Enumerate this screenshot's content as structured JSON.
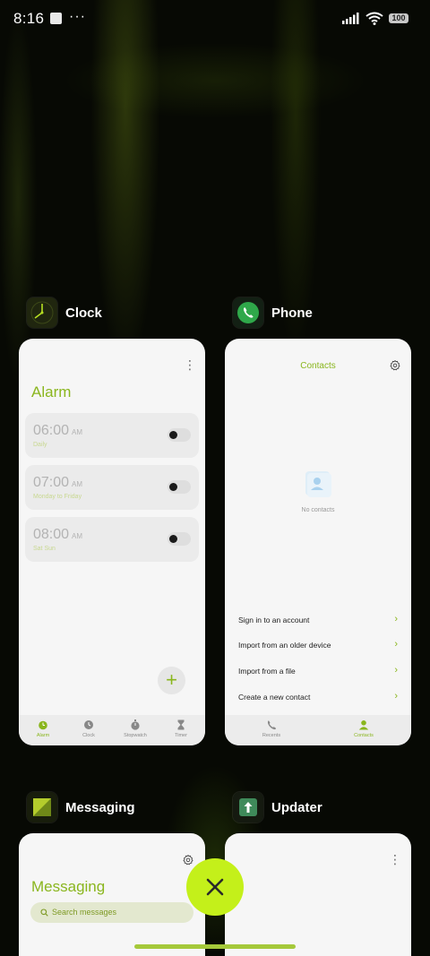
{
  "status_bar": {
    "time": "8:16",
    "battery": "100",
    "icons": [
      "square-notification-icon",
      "more-dots-icon",
      "signal-icon",
      "wifi-icon",
      "battery-icon"
    ]
  },
  "apps": {
    "clock": {
      "label": "Clock",
      "menu_icon": "⋮",
      "screen_title": "Alarm",
      "alarms": [
        {
          "time": "06:00",
          "ampm": "AM",
          "repeat": "Daily",
          "enabled": false
        },
        {
          "time": "07:00",
          "ampm": "AM",
          "repeat": "Monday to Friday",
          "enabled": false
        },
        {
          "time": "08:00",
          "ampm": "AM",
          "repeat": "Sat Sun",
          "enabled": false
        }
      ],
      "add_button": "+",
      "tabs": [
        "Alarm",
        "Clock",
        "Stopwatch",
        "Timer"
      ],
      "active_tab": "Alarm"
    },
    "phone": {
      "label": "Phone",
      "screen_title": "Contacts",
      "empty_text": "No contacts",
      "options": [
        "Sign in to an account",
        "Import from an older device",
        "Import from a file",
        "Create a new contact"
      ],
      "tabs": [
        "Recents",
        "Contacts"
      ],
      "active_tab": "Contacts"
    },
    "messaging": {
      "label": "Messaging",
      "screen_title": "Messaging",
      "search_placeholder": "Search messages"
    },
    "updater": {
      "label": "Updater"
    }
  },
  "close_icon": "close-icon",
  "colors": {
    "accent": "#8ab61e",
    "close_button": "#c4f01a"
  }
}
